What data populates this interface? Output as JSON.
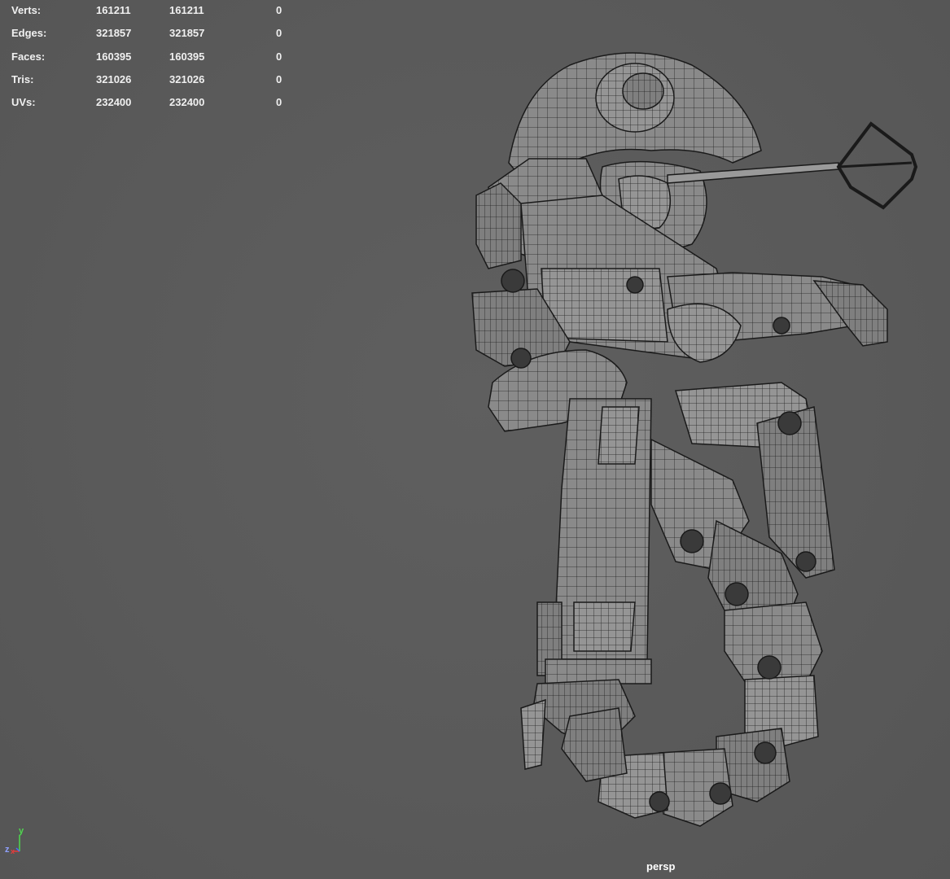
{
  "hud": {
    "rows": [
      {
        "label": "Verts:",
        "v1": "161211",
        "v2": "161211",
        "v3": "0"
      },
      {
        "label": "Edges:",
        "v1": "321857",
        "v2": "321857",
        "v3": "0"
      },
      {
        "label": "Faces:",
        "v1": "160395",
        "v2": "160395",
        "v3": "0"
      },
      {
        "label": "Tris:",
        "v1": "321026",
        "v2": "321026",
        "v3": "0"
      },
      {
        "label": "UVs:",
        "v1": "232400",
        "v2": "232400",
        "v3": "0"
      }
    ]
  },
  "camera": {
    "label": "persp"
  },
  "axis": {
    "y": "y",
    "z": "z",
    "x": "x",
    "colors": {
      "x": "#e23c3c",
      "y": "#4fd84f",
      "z": "#4a6bff"
    }
  },
  "colors": {
    "viewport_bg": "#5a5a5a",
    "mesh_fill": "#888888",
    "mesh_wire": "#1e1e1e"
  }
}
